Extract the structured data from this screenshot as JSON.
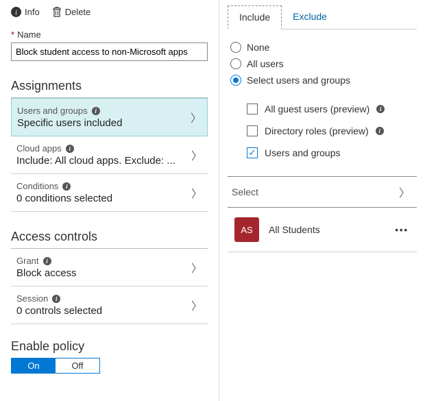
{
  "toolbar": {
    "info_label": "Info",
    "delete_label": "Delete"
  },
  "name_field": {
    "label": "Name",
    "value": "Block student access to non-Microsoft apps"
  },
  "sections": {
    "assignments": {
      "title": "Assignments",
      "rows": [
        {
          "label": "Users and groups",
          "value": "Specific users included",
          "selected": true
        },
        {
          "label": "Cloud apps",
          "value": "Include: All cloud apps. Exclude: ...",
          "selected": false
        },
        {
          "label": "Conditions",
          "value": "0 conditions selected",
          "selected": false
        }
      ]
    },
    "access_controls": {
      "title": "Access controls",
      "rows": [
        {
          "label": "Grant",
          "value": "Block access",
          "selected": false
        },
        {
          "label": "Session",
          "value": "0 controls selected",
          "selected": false
        }
      ]
    },
    "enable_policy": {
      "title": "Enable policy",
      "options": [
        "On",
        "Off"
      ],
      "active": "On"
    }
  },
  "right": {
    "tabs": [
      {
        "label": "Include",
        "active": true
      },
      {
        "label": "Exclude",
        "active": false
      }
    ],
    "radios": [
      {
        "label": "None",
        "checked": false
      },
      {
        "label": "All users",
        "checked": false
      },
      {
        "label": "Select users and groups",
        "checked": true
      }
    ],
    "checks": [
      {
        "label": "All guest users (preview)",
        "checked": false,
        "info": true
      },
      {
        "label": "Directory roles (preview)",
        "checked": false,
        "info": true
      },
      {
        "label": "Users and groups",
        "checked": true,
        "info": false
      }
    ],
    "select_label": "Select",
    "entity": {
      "initials": "AS",
      "name": "All Students"
    }
  }
}
